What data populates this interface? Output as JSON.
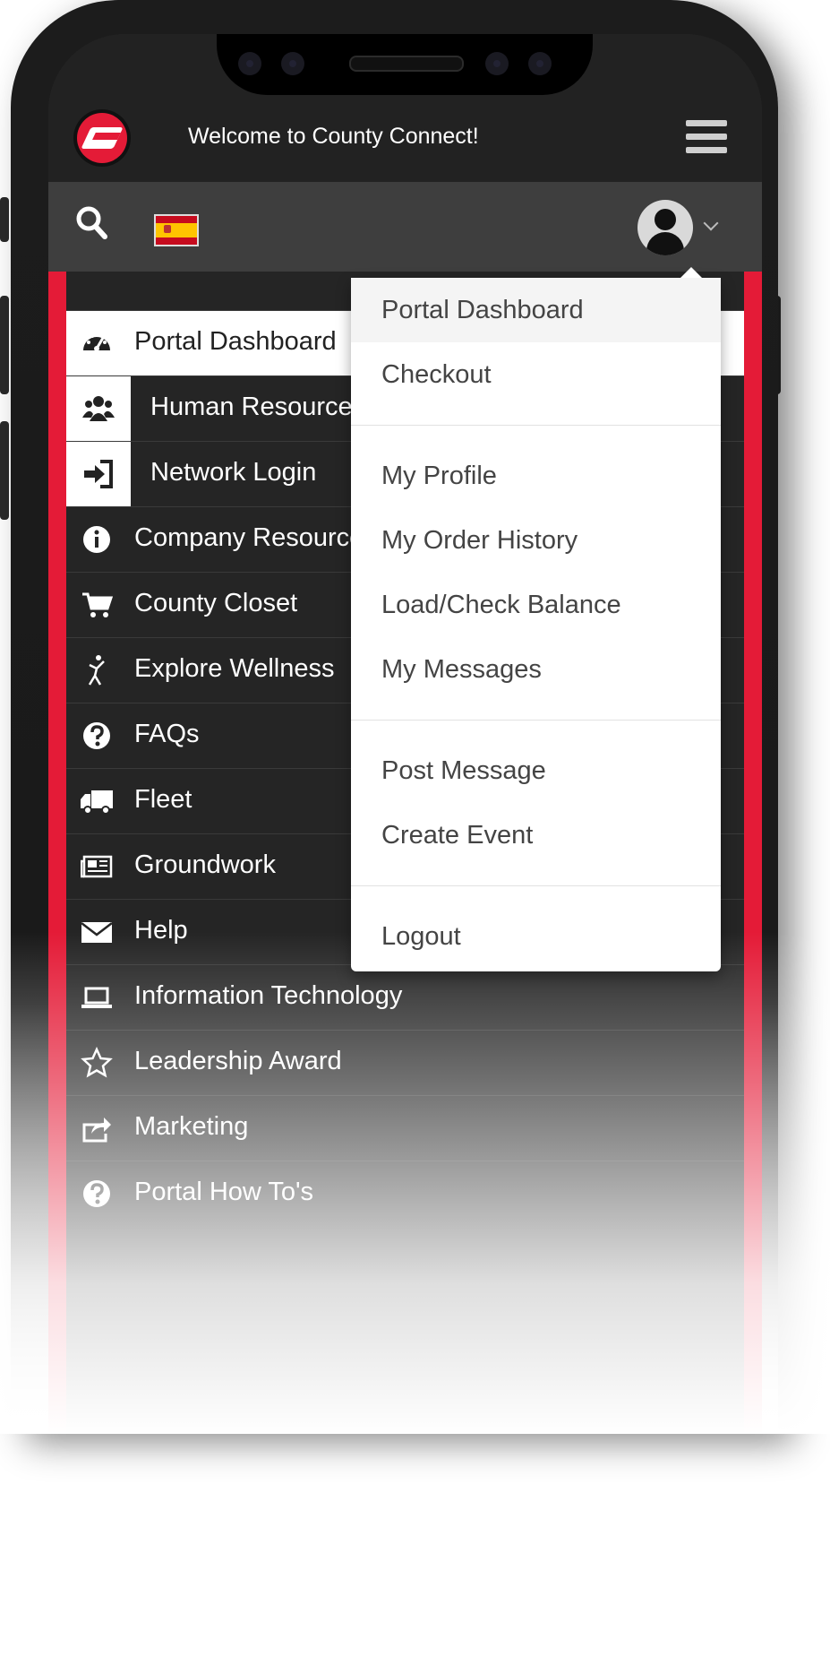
{
  "header": {
    "title": "Welcome to County Connect!"
  },
  "toolbar": {
    "language_flag": "spain-flag-icon"
  },
  "colors": {
    "accent": "#e41b37",
    "header_bg": "#222222",
    "toolbar_bg": "#3e3e3e",
    "menu_bg": "#252525"
  },
  "sidebar": {
    "items": [
      {
        "label": "Portal Dashboard",
        "icon": "dashboard-icon"
      },
      {
        "label": "Human Resources",
        "icon": "users-icon"
      },
      {
        "label": "Network Login",
        "icon": "sign-in-icon"
      },
      {
        "label": "Company Resources",
        "icon": "info-icon"
      },
      {
        "label": "County Closet",
        "icon": "cart-icon"
      },
      {
        "label": "Explore Wellness",
        "icon": "wellness-icon"
      },
      {
        "label": "FAQs",
        "icon": "question-icon"
      },
      {
        "label": "Fleet",
        "icon": "truck-icon"
      },
      {
        "label": "Groundwork",
        "icon": "newspaper-icon"
      },
      {
        "label": "Help",
        "icon": "envelope-icon"
      },
      {
        "label": "Information Technology",
        "icon": "laptop-icon"
      },
      {
        "label": "Leadership Award",
        "icon": "star-icon"
      },
      {
        "label": "Marketing",
        "icon": "share-icon"
      },
      {
        "label": "Portal How To's",
        "icon": "question-icon"
      }
    ]
  },
  "user_menu": {
    "group1": [
      "Portal Dashboard",
      "Checkout"
    ],
    "group2": [
      "My Profile",
      "My Order History",
      "Load/Check Balance",
      "My Messages"
    ],
    "group3": [
      "Post Message",
      "Create Event"
    ],
    "group4": [
      "Logout"
    ]
  }
}
